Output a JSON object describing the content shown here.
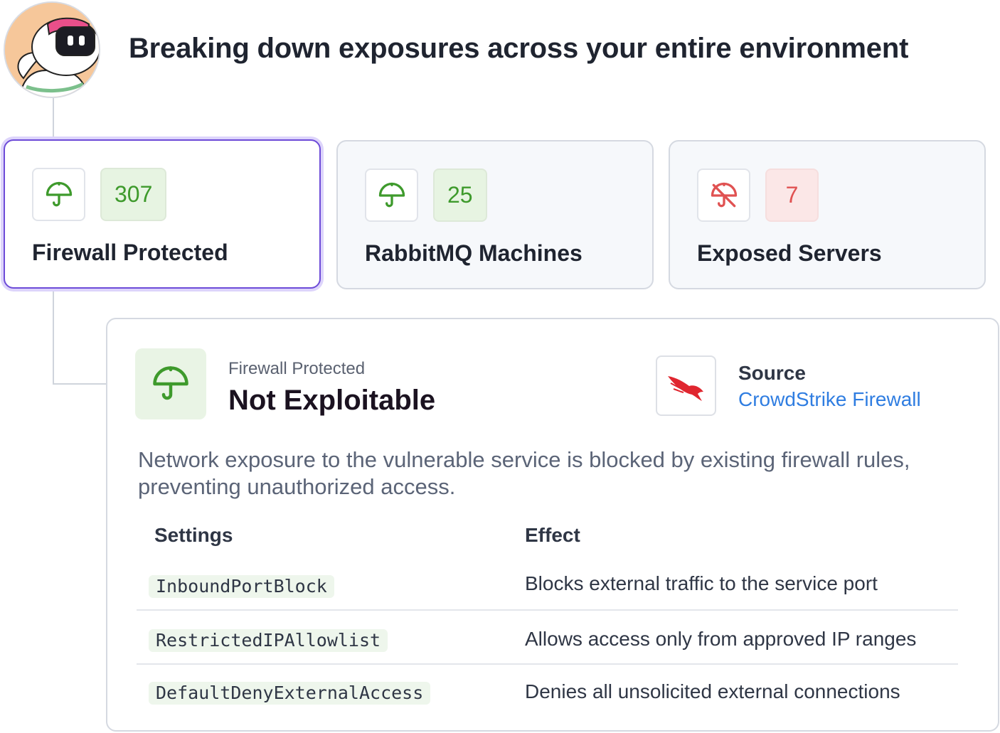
{
  "header": {
    "title": "Breaking down exposures across your entire environment"
  },
  "colors": {
    "accent_selected": "#6d4bd8",
    "protected_green": "#3e9a2c",
    "exposed_red": "#e05252",
    "link_blue": "#2f7de1"
  },
  "cards": [
    {
      "icon": "umbrella-icon",
      "count": "307",
      "label": "Firewall Protected",
      "status": "protected",
      "selected": true
    },
    {
      "icon": "umbrella-icon",
      "count": "25",
      "label": "RabbitMQ Machines",
      "status": "protected",
      "selected": false
    },
    {
      "icon": "umbrella-off-icon",
      "count": "7",
      "label": "Exposed Servers",
      "status": "exposed",
      "selected": false
    }
  ],
  "detail": {
    "icon": "umbrella-icon",
    "kicker": "Firewall Protected",
    "heading": "Not Exploitable",
    "source_label": "Source",
    "source_logo": "crowdstrike-falcon-logo",
    "source_link": "CrowdStrike Firewall",
    "description": "Network exposure to the vulnerable service is blocked by existing firewall rules, preventing unauthorized access.",
    "table": {
      "headers": [
        "Settings",
        "Effect"
      ],
      "rows": [
        {
          "setting": "InboundPortBlock",
          "effect": "Blocks external traffic to the service port"
        },
        {
          "setting": "RestrictedIPAllowlist",
          "effect": "Allows access only from approved IP ranges"
        },
        {
          "setting": "DefaultDenyExternalAccess",
          "effect": "Denies all unsolicited external connections"
        }
      ]
    }
  }
}
